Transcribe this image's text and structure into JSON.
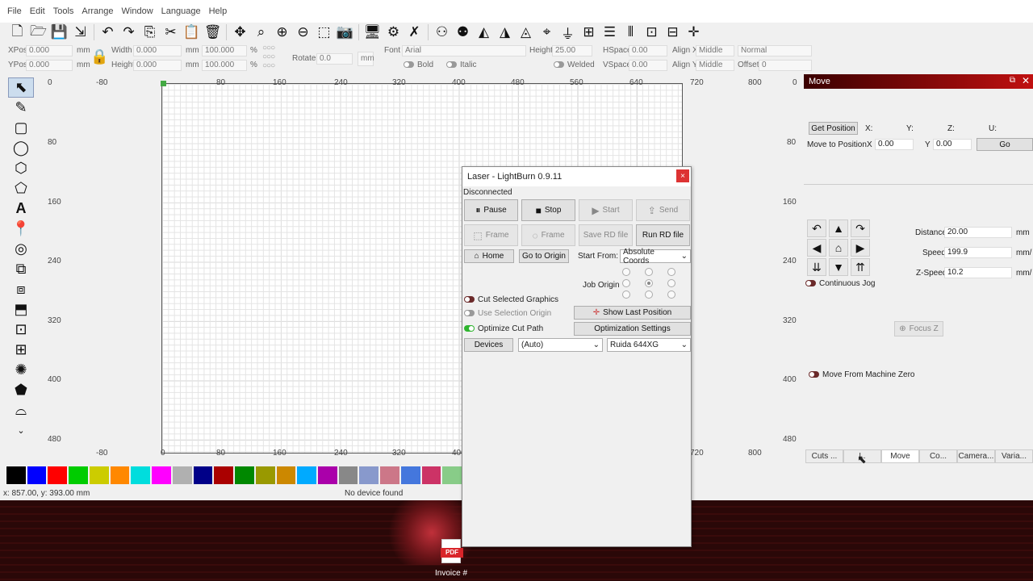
{
  "menu": [
    "File",
    "Edit",
    "Tools",
    "Arrange",
    "Window",
    "Language",
    "Help"
  ],
  "props": {
    "xpos_label": "XPos",
    "xpos": "0.000",
    "ypos_label": "YPos",
    "ypos": "0.000",
    "unit_mm": "mm",
    "width_label": "Width",
    "width": "0.000",
    "height_label": "Height",
    "height": "0.000",
    "pct_w": "100.000",
    "pct_h": "100.000",
    "pct": "%",
    "rotate_label": "Rotate",
    "rotate": "0.0",
    "mm_btn": "mm",
    "font_label": "Font",
    "font": "Arial",
    "fheight_label": "Height",
    "fheight": "25.00",
    "hspace_label": "HSpace",
    "hspace": "0.00",
    "vspace_label": "VSpace",
    "vspace": "0.00",
    "alignx_label": "Align X",
    "alignx": "Middle",
    "aligny_label": "Align Y",
    "aligny": "Middle",
    "normal": "Normal",
    "offset_label": "Offset",
    "offset": "0",
    "bold": "Bold",
    "italic": "Italic",
    "welded": "Welded"
  },
  "ruler_top": [
    "-80",
    "80",
    "160",
    "240",
    "320",
    "400",
    "480",
    "560",
    "640",
    "720",
    "800"
  ],
  "ruler_top_zero": "0",
  "ruler_bottom": [
    "-80",
    "0",
    "80",
    "160",
    "240",
    "320",
    "400",
    "720",
    "800"
  ],
  "ruler_left": [
    "0",
    "80",
    "160",
    "240",
    "320",
    "400",
    "480"
  ],
  "ruler_right": [
    "0",
    "80",
    "160",
    "240",
    "320",
    "400",
    "480"
  ],
  "palette": [
    "#000000",
    "#0000ff",
    "#ff0000",
    "#00cc00",
    "#cccc00",
    "#ff8800",
    "#00dddd",
    "#ff00ff",
    "#b0b0b0",
    "#000088",
    "#aa0000",
    "#008800",
    "#999900",
    "#cc8800",
    "#00aaff",
    "#aa00aa",
    "#888888",
    "#8899cc",
    "#cc7788",
    "#4477dd",
    "#cc3366",
    "#88cc88"
  ],
  "status": {
    "coords": "x: 857.00, y: 393.00 mm",
    "device": "No device found"
  },
  "laser": {
    "title": "Laser - LightBurn 0.9.11",
    "close": "×",
    "state": "Disconnected",
    "pause": "Pause",
    "stop": "Stop",
    "start": "Start",
    "send": "Send",
    "frame1": "Frame",
    "frame2": "Frame",
    "save_rd": "Save RD file",
    "run_rd": "Run RD file",
    "home": "Home",
    "go_origin": "Go to Origin",
    "start_from_label": "Start From:",
    "start_from": "Absolute Coords",
    "job_origin": "Job Origin",
    "cut_selected": "Cut Selected Graphics",
    "use_sel_origin": "Use Selection Origin",
    "show_last": "Show Last Position",
    "optimize": "Optimize Cut Path",
    "opt_settings": "Optimization Settings",
    "devices": "Devices",
    "auto": "(Auto)",
    "device_model": "Ruida 644XG"
  },
  "move": {
    "title": "Move",
    "get_pos": "Get Position",
    "x_lbl": "X:",
    "y_lbl": "Y:",
    "z_lbl": "Z:",
    "u_lbl": "U:",
    "move_to": "Move to Position",
    "x": "X",
    "xval": "0.00",
    "y": "Y",
    "yval": "0.00",
    "go": "Go",
    "distance_label": "Distance",
    "distance": "20.00",
    "dist_unit": "mm",
    "speed_label": "Speed",
    "speed": "199.9",
    "speed_unit": "mm/",
    "zspeed_label": "Z-Speed",
    "zspeed": "10.2",
    "zspeed_unit": "mm/",
    "continuous": "Continuous Jog",
    "focus": "Focus Z",
    "machine_zero": "Move From Machine Zero"
  },
  "tabs": [
    "Cuts ...",
    "L.",
    "Move",
    "Co...",
    "Camera...",
    "Varia..."
  ],
  "desktop": {
    "icon_label": "PDF",
    "file": "Invoice #"
  }
}
